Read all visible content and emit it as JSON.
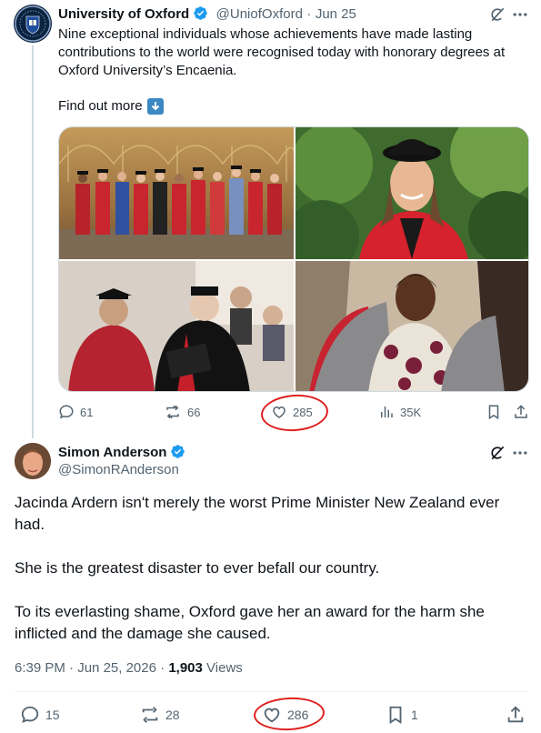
{
  "tweet1": {
    "author_name": "University of Oxford",
    "handle": "@UniofOxford",
    "date": "Jun 25",
    "text": "Nine exceptional individuals whose achievements have made lasting contributions to the world were recognised today with honorary degrees at Oxford University’s Encaenia.",
    "find_out_more": "Find out more",
    "arrow_emoji": "⬇️",
    "replies": "61",
    "reposts": "66",
    "likes": "285",
    "views": "35K"
  },
  "tweet2": {
    "author_name": "Simon Anderson",
    "handle": "@SimonRAnderson",
    "paragraphs": [
      "Jacinda Ardern isn't merely the worst Prime Minister New Zealand ever had.",
      "She is the greatest disaster to ever befall our country.",
      "To its everlasting shame, Oxford gave her an award for the harm she inflicted and the damage she caused."
    ],
    "time": "6:39 PM",
    "date": "Jun 25, 2026",
    "views_count": "1,903",
    "views_label": "Views",
    "replies": "15",
    "reposts": "28",
    "likes": "286",
    "bookmarks": "1"
  },
  "colors": {
    "verified_blue": "#1d9bf0",
    "muted": "#536471",
    "annotation_red": "#e02020"
  },
  "icons": [
    "oxford-crest-icon",
    "verified-icon",
    "grok-icon",
    "more-icon",
    "reply-icon",
    "repost-icon",
    "like-icon",
    "views-icon",
    "bookmark-icon",
    "share-icon"
  ]
}
